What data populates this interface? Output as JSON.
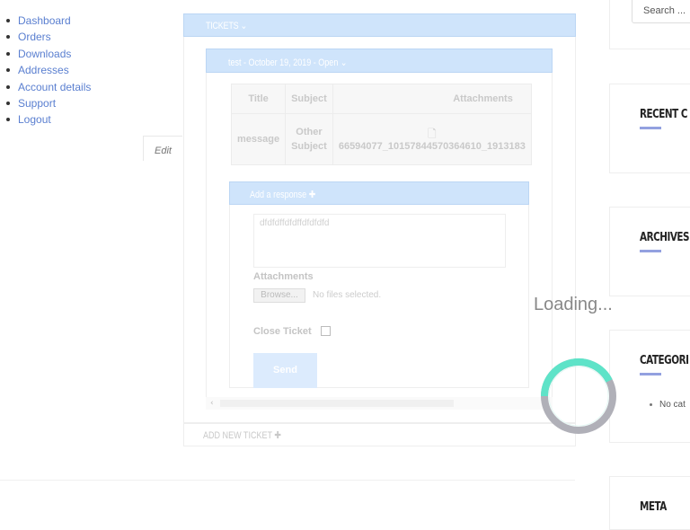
{
  "nav": {
    "items": [
      {
        "label": "Dashboard"
      },
      {
        "label": "Orders"
      },
      {
        "label": "Downloads"
      },
      {
        "label": "Addresses"
      },
      {
        "label": "Account details"
      },
      {
        "label": "Support"
      },
      {
        "label": "Logout"
      }
    ],
    "edit_label": "Edit"
  },
  "tickets": {
    "header": "TICKETS ⌄",
    "ticket_header": "test - October 19, 2019 - Open ⌄",
    "table": {
      "columns": [
        "Title",
        "Subject",
        "Attachments"
      ],
      "rows": [
        {
          "title": "message",
          "subject": "Other Subject",
          "attachment": "66594077_10157844570364610_1913183"
        }
      ]
    },
    "response": {
      "header": "Add a response ✚",
      "message_value": "dfdfdffdfdffdfdfdfd",
      "attachments_label": "Attachments",
      "browse_label": "Browse...",
      "no_files_text": "No files selected.",
      "close_ticket_label": "Close Ticket",
      "close_ticket_checked": false,
      "send_label": "Send"
    },
    "scroll_arrow": "‹",
    "add_new_label": "ADD NEW TICKET ✚"
  },
  "sidebar": {
    "search_placeholder": "Search ...",
    "widgets": [
      {
        "title": "RECENT C"
      },
      {
        "title": "ARCHIVES"
      },
      {
        "title": "CATEGORI"
      },
      {
        "title": "META"
      }
    ],
    "no_categories": "No cat"
  },
  "overlay": {
    "loading_text": "Loading...",
    "colors": {
      "spinner_accent": "#5ee3c8",
      "spinner_track": "#b0b0b8"
    }
  }
}
